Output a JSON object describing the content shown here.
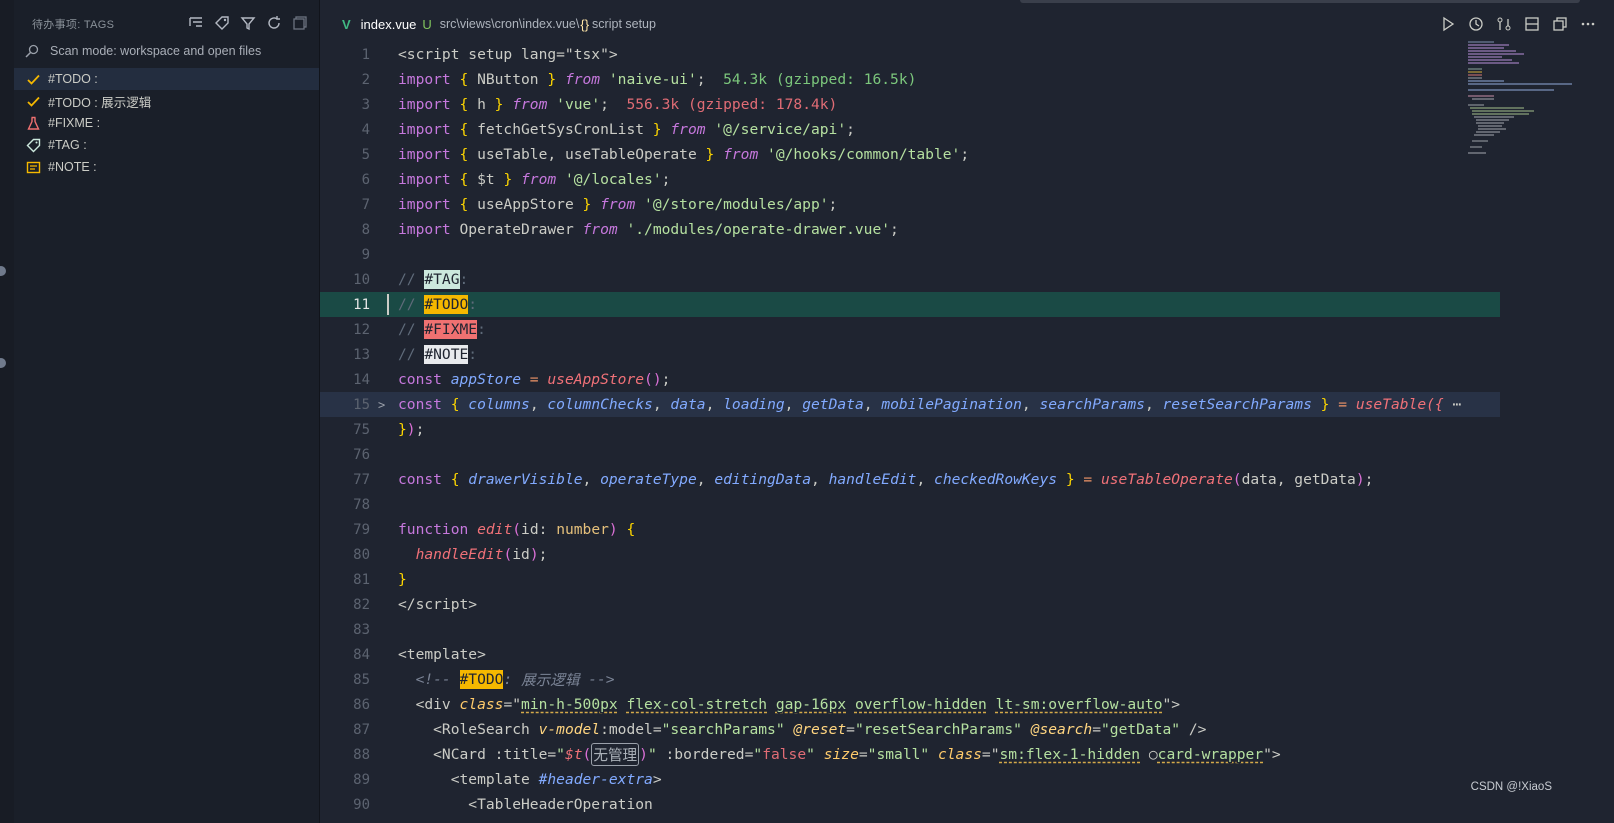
{
  "sidebar": {
    "title": "待办事项: TAGS",
    "scan_mode": "Scan mode: workspace and open files",
    "items": [
      {
        "label": "#TODO :"
      },
      {
        "label": "#TODO : 展示逻辑"
      },
      {
        "label": "#FIXME :"
      },
      {
        "label": "#TAG :"
      },
      {
        "label": "#NOTE :"
      }
    ]
  },
  "tab": {
    "filename": "index.vue",
    "status": "U",
    "path": "src\\views\\cron\\index.vue\\",
    "braces": "{}",
    "symbol": "script setup"
  },
  "code": {
    "line_numbers": [
      "1",
      "2",
      "3",
      "4",
      "5",
      "6",
      "7",
      "8",
      "9",
      "10",
      "11",
      "12",
      "13",
      "14",
      "15",
      "75",
      "76",
      "77",
      "78",
      "79",
      "80",
      "81",
      "82",
      "83",
      "84",
      "85",
      "86",
      "87",
      "88",
      "89",
      "90"
    ],
    "l1": "<script setup lang=\"tsx\">",
    "l2_sizes": "54.3k (gzipped: 16.5k)",
    "l3_sizes": "556.3k (gzipped: 178.4k)",
    "l15_end": "useTable({",
    "l15_ellipsis": "⋯",
    "comment_tag": "#TAG",
    "comment_todo": "#TODO",
    "comment_fixme": "#FIXME",
    "comment_note": "#NOTE",
    "l85_todo_text": "展示逻辑",
    "l88_hint": "无管理"
  },
  "watermark": "CSDN @!XiaoS",
  "colors": {
    "todo_badge": "#f5b800",
    "fixme_badge": "#f07171",
    "tag_badge": "#cce8dd",
    "note_badge": "#e8eaed",
    "active_line": "#1a4a45"
  }
}
